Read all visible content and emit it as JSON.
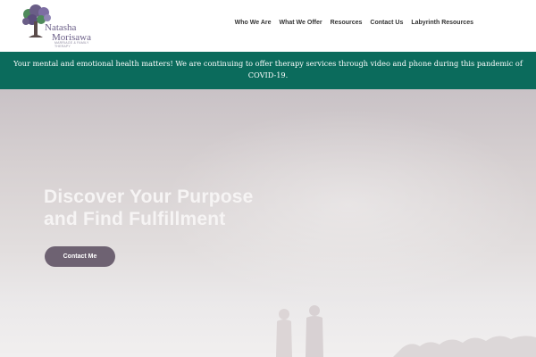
{
  "logo": {
    "name_line1": "Natasha",
    "name_line2": "Morisawa",
    "tagline": "Marriage & Family Therapy"
  },
  "nav": {
    "items": [
      "Who We Are",
      "What We Offer",
      "Resources",
      "Contact Us",
      "Labyrinth Resources"
    ]
  },
  "banner": {
    "text": "Your mental and emotional health matters! We are continuing to offer therapy services through video and phone during this pandemic of COVID-19."
  },
  "hero": {
    "title_line1": "Discover Your Purpose",
    "title_line2": "and Find Fulfillment",
    "button_label": "Contact Me"
  },
  "colors": {
    "banner_bg": "#0b6b5c",
    "button_bg": "#6e6272",
    "logo_purple": "#6a5e87",
    "logo_green": "#4f8a5b"
  },
  "icons": {
    "logo_mark": "tree-logo-icon"
  }
}
